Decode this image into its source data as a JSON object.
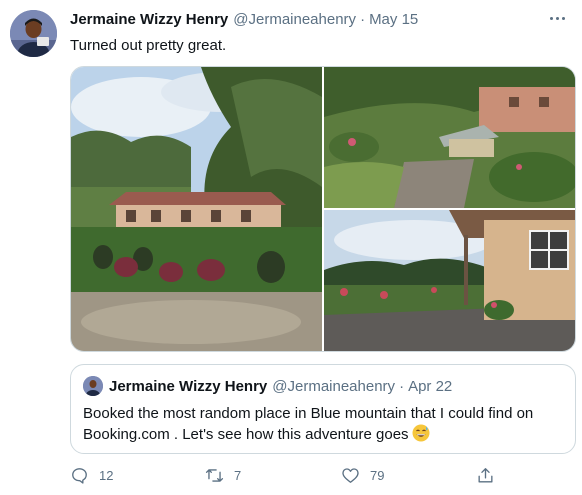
{
  "tweet": {
    "author_name": "Jermaine Wizzy Henry",
    "author_handle": "@Jermaineahenry",
    "separator": "·",
    "date": "May 15",
    "text": "Turned out pretty great.",
    "photos": [
      "house-with-garden-photo",
      "garden-path-photo",
      "verandah-view-photo"
    ],
    "more_icon": "more-horizontal-icon"
  },
  "quote": {
    "author_name": "Jermaine Wizzy Henry",
    "author_handle": "@Jermaineahenry",
    "separator": "·",
    "date": "Apr 22",
    "text": "Booked the most random place in Blue mountain that I could find on Booking.com . Let's see how this adventure goes",
    "emoji": "grinning-sweat-emoji"
  },
  "actions": {
    "reply_count": "12",
    "retweet_count": "7",
    "like_count": "79",
    "reply_icon": "reply-icon",
    "retweet_icon": "retweet-icon",
    "like_icon": "heart-icon",
    "share_icon": "share-icon"
  },
  "colors": {
    "text_primary": "#0f1419",
    "text_secondary": "#5b7083",
    "border": "#cfd9de"
  }
}
